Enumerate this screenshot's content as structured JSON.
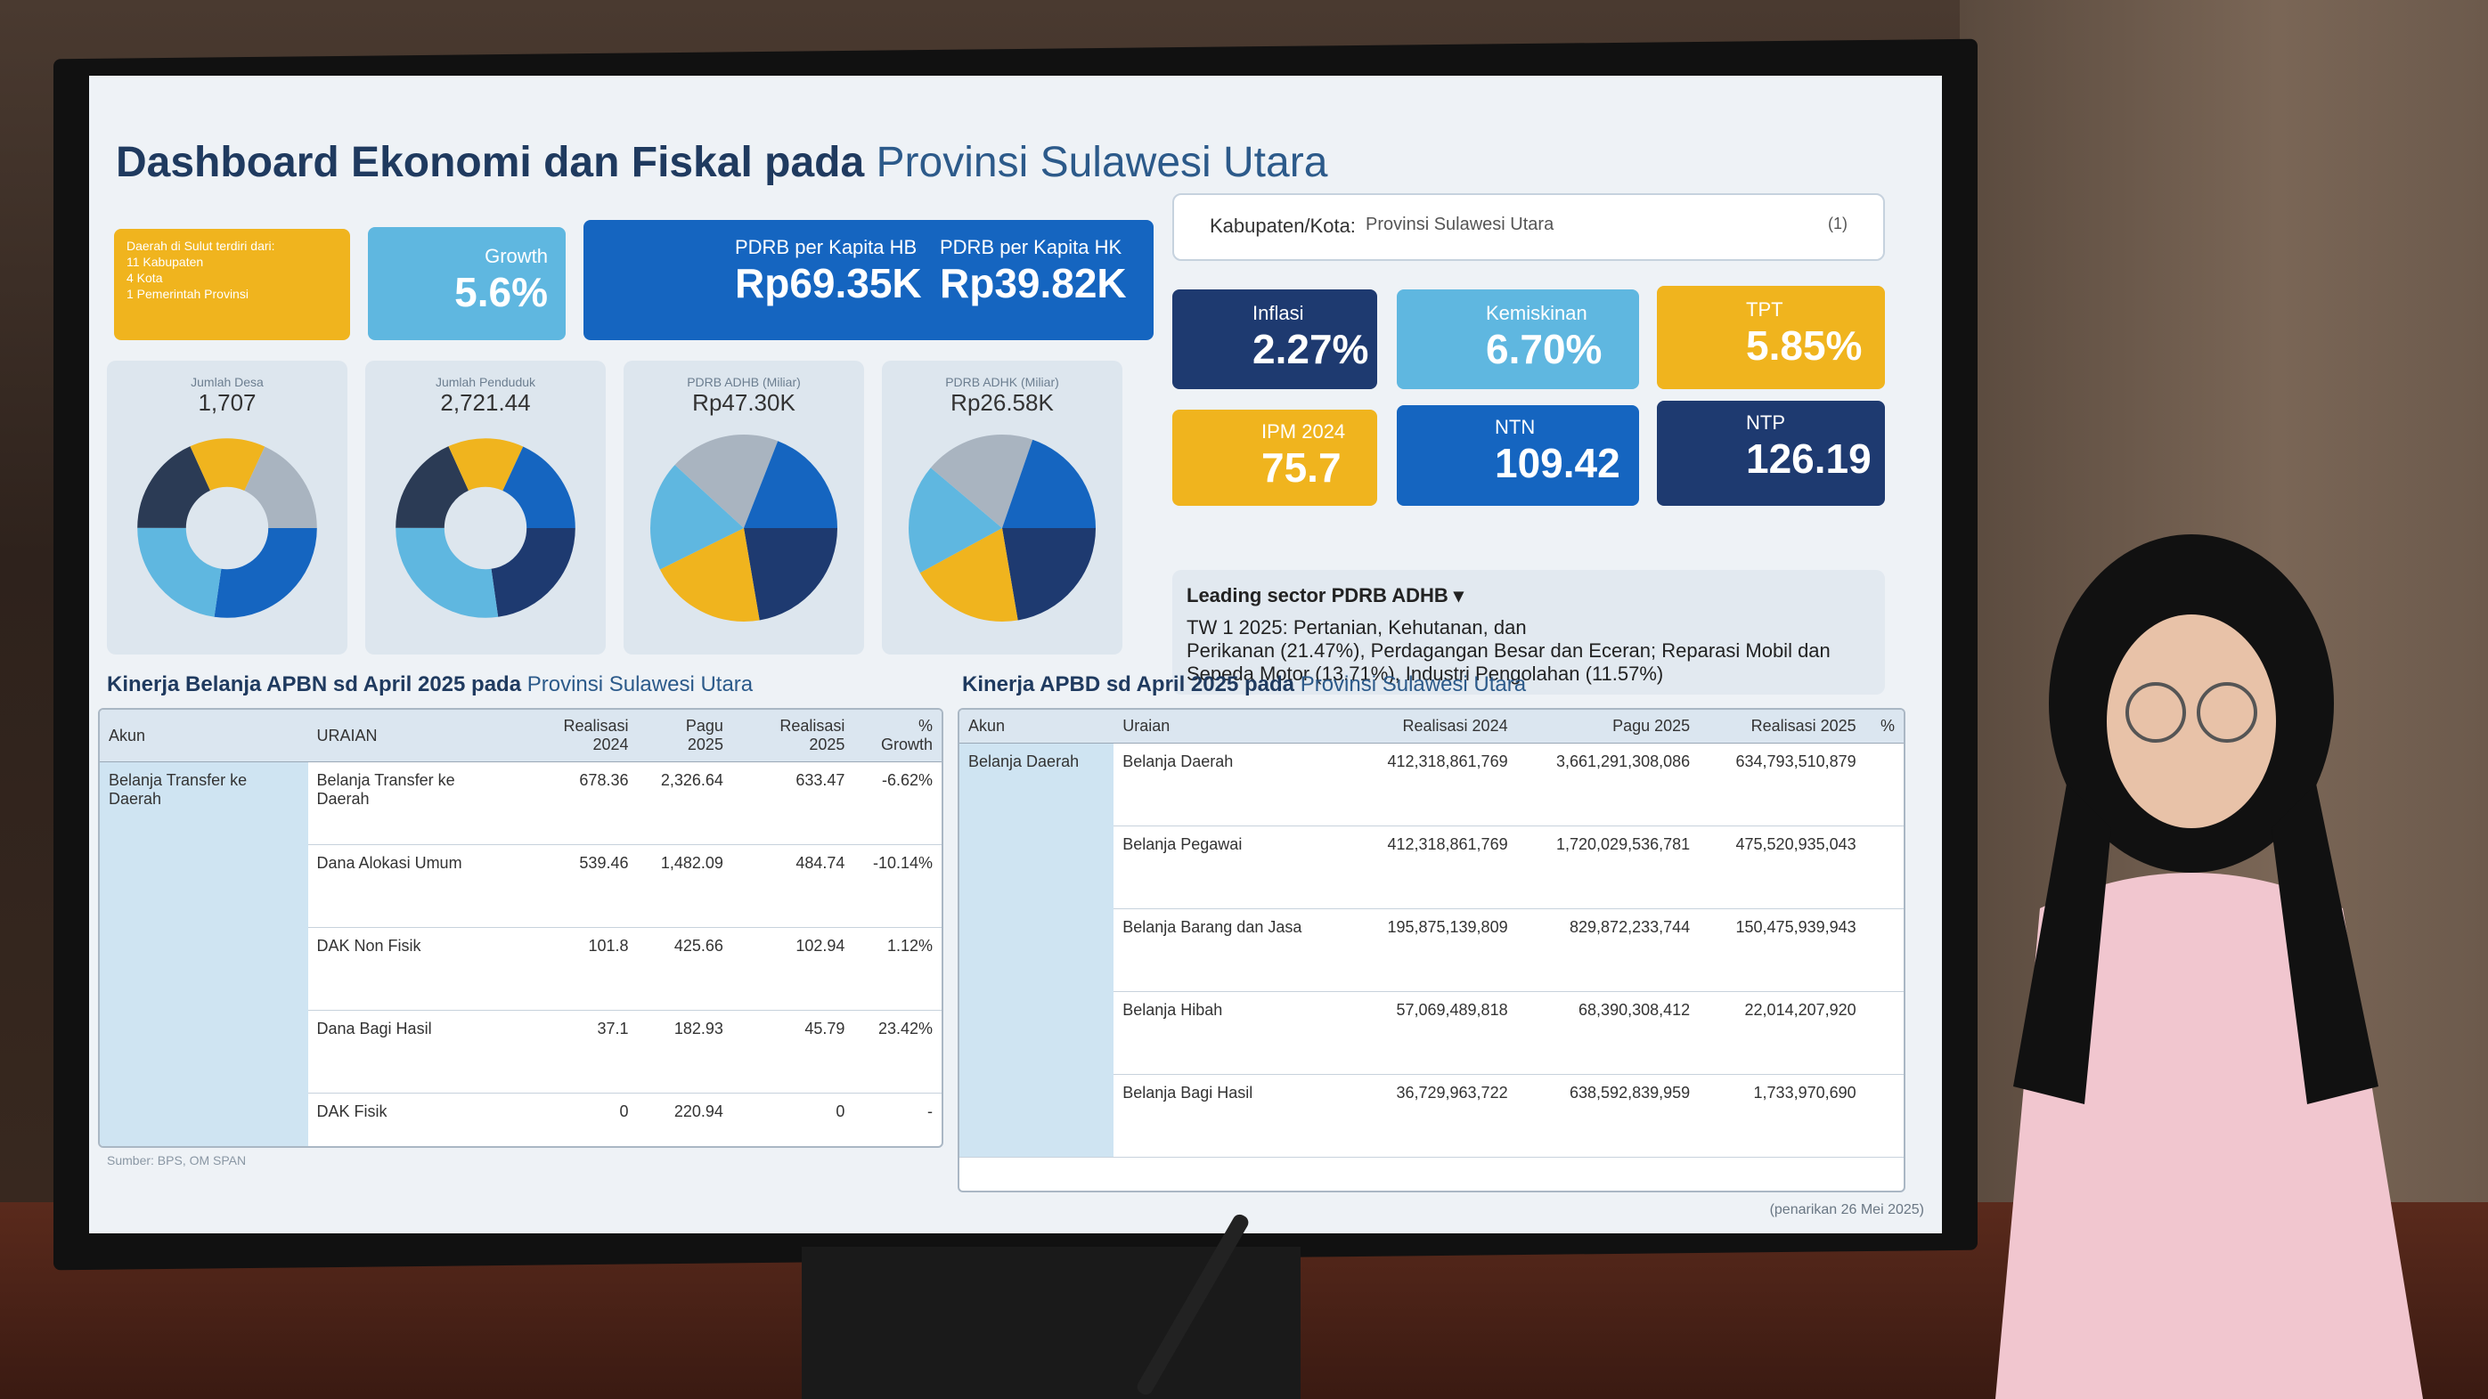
{
  "title": {
    "bold": "Dashboard Ekonomi dan Fiskal pada",
    "region": "Provinsi Sulawesi Utara"
  },
  "info_tile": {
    "l1": "Daerah di Sulut terdiri dari:",
    "l2": "11 Kabupaten",
    "l3": "4 Kota",
    "l4": "1 Pemerintah Provinsi"
  },
  "growth": {
    "label": "Growth",
    "value": "5.6%"
  },
  "pdrb_hb": {
    "label": "PDRB per Kapita HB",
    "value": "Rp69.35K"
  },
  "pdrb_hk": {
    "label": "PDRB per Kapita HK",
    "value": "Rp39.82K"
  },
  "filter": {
    "label": "Kabupaten/Kota:",
    "value": "Provinsi Sulawesi Utara",
    "count": "(1)"
  },
  "kpi": {
    "inflasi": {
      "label": "Inflasi",
      "value": "2.27%"
    },
    "kemiskinan": {
      "label": "Kemiskinan",
      "value": "6.70%"
    },
    "tpt": {
      "label": "TPT",
      "value": "5.85%"
    },
    "ipm": {
      "label": "IPM 2024",
      "value": "75.7"
    },
    "ntn": {
      "label": "NTN",
      "value": "109.42"
    },
    "ntp": {
      "label": "NTP",
      "value": "126.19"
    }
  },
  "donuts": [
    {
      "label": "Jumlah Desa",
      "value": "1,707"
    },
    {
      "label": "Jumlah Penduduk",
      "value": "2,721.44"
    },
    {
      "label": "PDRB ADHB (Miliar)",
      "value": "Rp47.30K"
    },
    {
      "label": "PDRB ADHK (Miliar)",
      "value": "Rp26.58K"
    }
  ],
  "sector": {
    "label": "Leading sector PDRB ADHB",
    "l1": "TW 1 2025: Pertanian, Kehutanan, dan",
    "l2": "Perikanan (21.47%), Perdagangan Besar dan Eceran; Reparasi Mobil dan",
    "l3": "Sepeda Motor (13.71%), Industri Pengolahan (11.57%)"
  },
  "apbn": {
    "title": "Kinerja Belanja APBN sd April 2025 pada",
    "region": "Provinsi Sulawesi Utara",
    "headers": [
      "Akun",
      "URAIAN",
      "Realisasi 2024",
      "Pagu 2025",
      "Realisasi 2025",
      "% Growth"
    ],
    "akun": "Belanja Transfer ke Daerah",
    "rows": [
      [
        "Belanja Transfer ke Daerah",
        "678.36",
        "2,326.64",
        "633.47",
        "-6.62%"
      ],
      [
        "Dana Alokasi Umum",
        "539.46",
        "1,482.09",
        "484.74",
        "-10.14%"
      ],
      [
        "DAK Non Fisik",
        "101.8",
        "425.66",
        "102.94",
        "1.12%"
      ],
      [
        "Dana Bagi Hasil",
        "37.1",
        "182.93",
        "45.79",
        "23.42%"
      ],
      [
        "DAK Fisik",
        "0",
        "220.94",
        "0",
        "-"
      ]
    ]
  },
  "apbd": {
    "title": "Kinerja APBD sd April 2025 pada",
    "region": "Provinsi Sulawesi Utara",
    "headers": [
      "Akun",
      "Uraian",
      "Realisasi 2024",
      "Pagu 2025",
      "Realisasi 2025",
      "%"
    ],
    "akun": "Belanja Daerah",
    "rows": [
      [
        "Belanja Daerah",
        "412,318,861,769",
        "3,661,291,308,086",
        "634,793,510,879"
      ],
      [
        "Belanja Pegawai",
        "412,318,861,769",
        "1,720,029,536,781",
        "475,520,935,043"
      ],
      [
        "Belanja Barang dan Jasa",
        "195,875,139,809",
        "829,872,233,744",
        "150,475,939,943"
      ],
      [
        "Belanja Hibah",
        "57,069,489,818",
        "68,390,308,412",
        "22,014,207,920"
      ],
      [
        "Belanja Bagi Hasil",
        "36,729,963,722",
        "638,592,839,959",
        "1,733,970,690"
      ]
    ]
  },
  "source": "Sumber: BPS, OM SPAN",
  "footnote": "(penarikan 26 Mei 2025)"
}
